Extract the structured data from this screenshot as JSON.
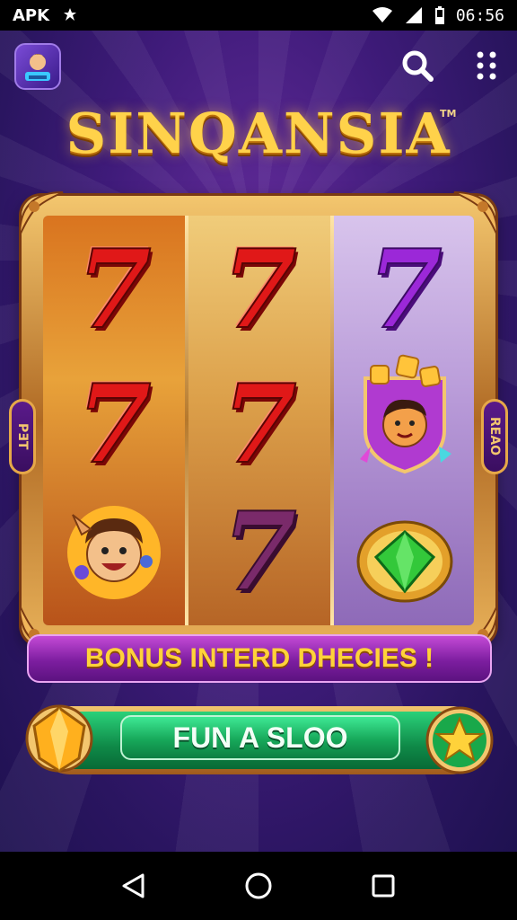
{
  "status_bar": {
    "app_label": "APK",
    "time": "06:56",
    "icons": [
      "bug-icon",
      "wifi-icon",
      "signal-icon",
      "battery-icon"
    ]
  },
  "header": {
    "app_icon": "game-app-icon",
    "search_icon": "search-icon",
    "menu_icon": "more-vertical-icon"
  },
  "game": {
    "title": "SINQANSIA",
    "trademark": "TM",
    "reels": [
      {
        "symbols": [
          "red-seven",
          "red-seven",
          "cartoon-character"
        ]
      },
      {
        "symbols": [
          "red-seven",
          "red-seven",
          "plum-seven"
        ]
      },
      {
        "symbols": [
          "purple-seven",
          "bonus-character-badge",
          "green-gem"
        ]
      }
    ],
    "seven_glyph": "7",
    "left_tab_label": "PƎT",
    "right_tab_label": "REAO",
    "bonus_text": "BONUS INTERD DHECIES !",
    "spin_label": "FUN A SLOO"
  },
  "colors": {
    "background": "#3f1b7a",
    "gold": "#ffd24a",
    "seven_red": "#e01818",
    "seven_purple": "#9b28d8",
    "spin_green": "#17a85a",
    "banner_purple": "#7d1ea0"
  },
  "nav_bar": {
    "back_icon": "back-triangle-icon",
    "home_icon": "home-circle-icon",
    "recents_icon": "recents-square-icon"
  }
}
